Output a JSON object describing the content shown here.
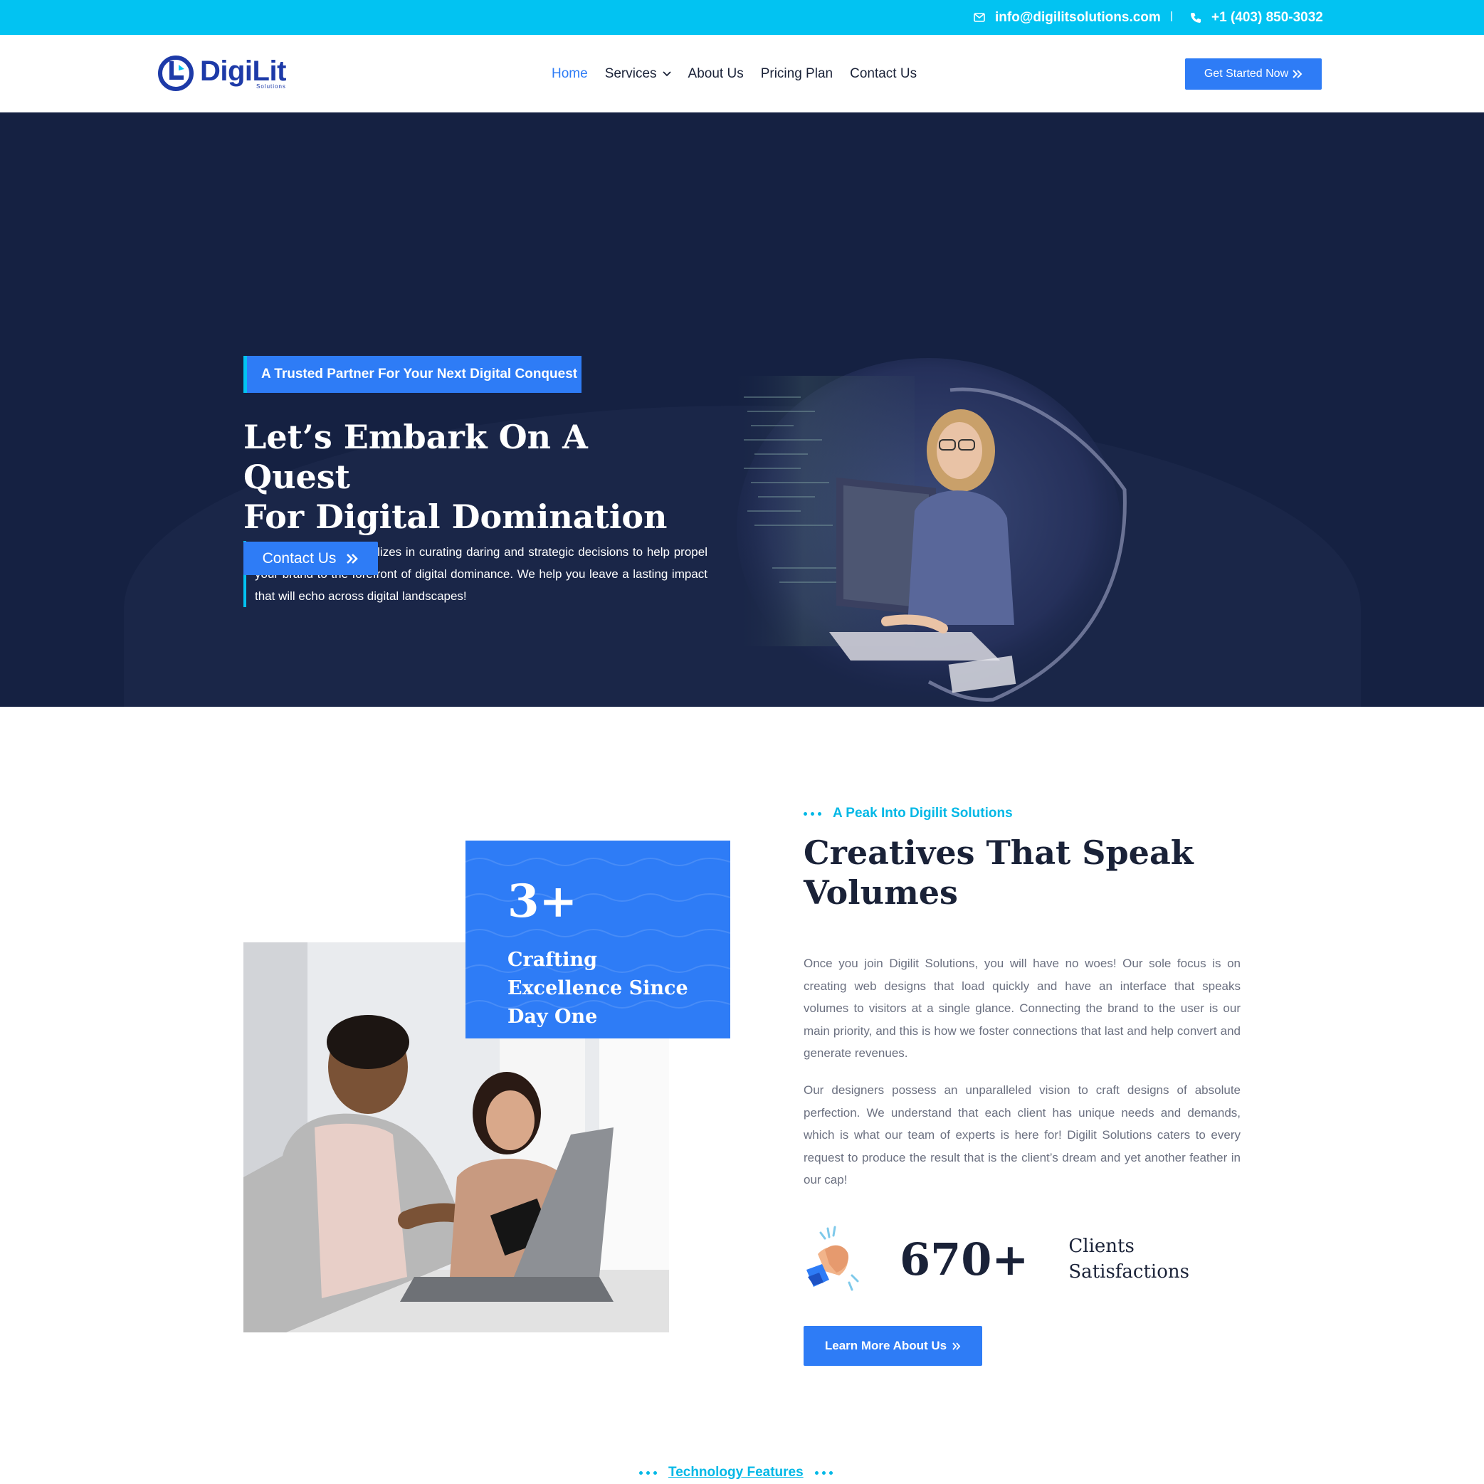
{
  "topbar": {
    "email": "info@digilitsolutions.com",
    "phone": "+1 (403) 850-3032",
    "email_icon": "mail-icon",
    "phone_icon": "phone-icon"
  },
  "header": {
    "logo_text": "DigiLit",
    "logo_sub": "Solutions",
    "nav": [
      {
        "label": "Home",
        "active": true
      },
      {
        "label": "Services",
        "dropdown": true
      },
      {
        "label": "About Us"
      },
      {
        "label": "Pricing Plan"
      },
      {
        "label": "Contact Us"
      }
    ],
    "cta_label": "Get Started Now"
  },
  "hero": {
    "badge": "A Trusted Partner For Your Next Digital Conquest",
    "title_line1": "Let’s Embark On A Quest",
    "title_line2": "For Digital Domination",
    "description": "Digilit Solutions specializes in curating daring and strategic decisions to help propel your brand to the forefront of digital dominance. We help you leave a lasting impact that will echo across digital landscapes!",
    "button_label": "Contact Us"
  },
  "about": {
    "stat_number": "3+",
    "stat_label": "Crafting Excellence Since Day One",
    "eyebrow": "A Peak Into Digilit Solutions",
    "title_line1": "Creatives That Speak",
    "title_line2": "Volumes",
    "paragraph1": "Once you join Digilit Solutions, you will have no woes! Our sole focus is on creating web designs that load quickly and have an interface that speaks volumes to visitors at a single glance. Connecting the brand to the user is our main priority, and this is how we foster connections that last and help convert and generate revenues.",
    "paragraph2": "Our designers possess an unparalleled vision to craft designs of absolute perfection. We understand that each client has unique needs and demands, which is what our team of experts is here for! Digilit Solutions caters to every request to produce the result that is the client’s dream and yet another feather in our cap!",
    "clients_number": "670+",
    "clients_label_line1": "Clients",
    "clients_label_line2": "Satisfactions",
    "clients_icon": "clapping-hands-icon",
    "button_label": "Learn More About Us"
  },
  "tech": {
    "label": "Technology Features"
  },
  "colors": {
    "accent": "#2e7cf6",
    "cyan": "#02c3f2",
    "hero_bg": "#152142",
    "dark_text": "#1a2238"
  }
}
